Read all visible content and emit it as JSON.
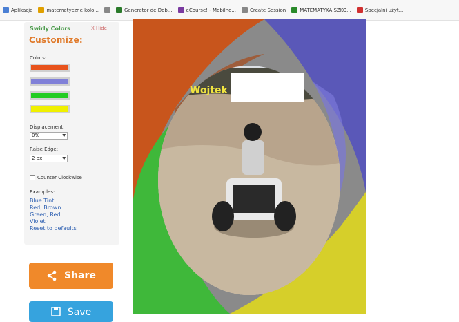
{
  "bookmarks": [
    {
      "label": "Aplikacje",
      "icon": "apps-icon",
      "color": "#4a7fd4"
    },
    {
      "label": "matematyczne kolo...",
      "icon": "bookmark-icon",
      "color": "#e0a000"
    },
    {
      "label": "",
      "icon": "page-icon",
      "color": "#888888"
    },
    {
      "label": "Generator de Dob...",
      "icon": "dollar-icon",
      "color": "#2a7a2a"
    },
    {
      "label": "eCourse! - Mobilno...",
      "icon": "ecourse-icon",
      "color": "#7a3aa0"
    },
    {
      "label": "Create Session",
      "icon": "page-icon",
      "color": "#888888"
    },
    {
      "label": "MATEMATYKA SZKO...",
      "icon": "matematyka-icon",
      "color": "#2a8a2a"
    },
    {
      "label": "Specjalni użyt...",
      "icon": "specjalni-icon",
      "color": "#d03030"
    }
  ],
  "panel": {
    "title": "Swirly Colors",
    "hide_label": "X Hide",
    "customize_label": "Customize:",
    "colors_label": "Colors:",
    "swatches": [
      "#e8531c",
      "#8080d8",
      "#22cc22",
      "#f0f000"
    ],
    "displacement_label": "Displacement:",
    "displacement_value": "0%",
    "raise_edge_label": "Raise Edge:",
    "raise_edge_value": "2 px",
    "counter_clockwise_label": "Counter Clockwise",
    "examples_label": "Examples:",
    "examples": [
      "Blue Tint",
      "Red, Brown",
      "Green, Red",
      "Violet",
      "Reset to defaults"
    ]
  },
  "share_button": {
    "label": "Share"
  },
  "save_button": {
    "label": "Save"
  },
  "photo": {
    "caption": "Wojtek"
  }
}
